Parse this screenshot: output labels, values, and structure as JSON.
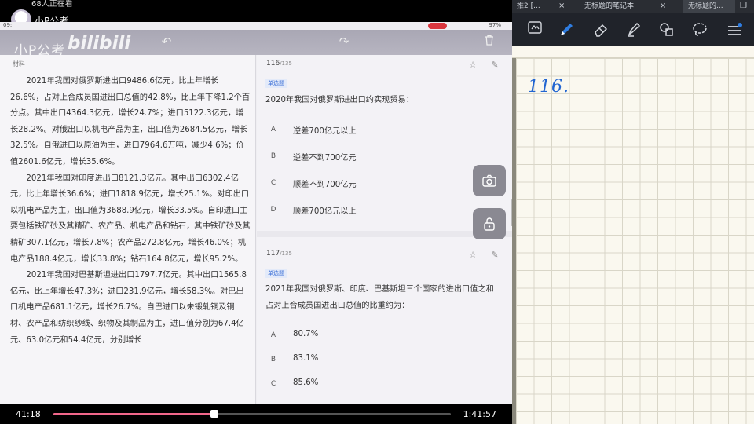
{
  "stream": {
    "viewer_count": "68人正在看",
    "streamer_name": "小P公考"
  },
  "tablet": {
    "status_time": "09:",
    "battery": "97%",
    "watermark_text": "小P公考",
    "watermark_logo": "bilibili",
    "toolbar_icons": [
      "undo-icon",
      "redo-icon",
      "trash-icon"
    ]
  },
  "material": {
    "label": "材料",
    "paragraphs": [
      "2021年我国对俄罗斯进出口9486.6亿元，比上年增长26.6%，占对上合成员国进出口总值的42.8%，比上年下降1.2个百分点。其中出口4364.3亿元，增长24.7%；进口5122.3亿元，增长28.2%。对俄出口以机电产品为主，出口值为2684.5亿元，增长32.5%。自俄进口以原油为主，进口7964.6万吨，减少4.6%；价值2601.6亿元，增长35.6%。",
      "2021年我国对印度进出口8121.3亿元。其中出口6302.4亿元，比上年增长36.6%；进口1818.9亿元，增长25.1%。对印出口以机电产品为主，出口值为3688.9亿元，增长33.5%。自印进口主要包括铁矿砂及其精矿、农产品、机电产品和钻石，其中铁矿砂及其精矿307.1亿元，增长7.8%；农产品272.8亿元，增长46.0%；机电产品188.4亿元，增长33.8%；钻石164.8亿元，增长95.2%。",
      "2021年我国对巴基斯坦进出口1797.7亿元。其中出口1565.8亿元，比上年增长47.3%；进口231.9亿元，增长58.3%。对巴出口机电产品681.1亿元，增长26.7%。自巴进口以未锻轧铜及铜材、农产品和纺织纱线、织物及其制品为主，进口值分别为67.4亿元、63.0亿元和54.4亿元，分别增长"
    ]
  },
  "questions": [
    {
      "number": "116",
      "total": "/135",
      "type": "单选题",
      "stem": "2020年我国对俄罗斯进出口约实现贸易：",
      "options": [
        {
          "letter": "A",
          "text": "逆差700亿元以上"
        },
        {
          "letter": "B",
          "text": "逆差不到700亿元"
        },
        {
          "letter": "C",
          "text": "顺差不到700亿元"
        },
        {
          "letter": "D",
          "text": "顺差700亿元以上"
        }
      ]
    },
    {
      "number": "117",
      "total": "/135",
      "type": "单选题",
      "stem": "2021年我国对俄罗斯、印度、巴基斯坦三个国家的进出口值之和占对上合成员国进出口总值的比重约为：",
      "options": [
        {
          "letter": "A",
          "text": "80.7%"
        },
        {
          "letter": "B",
          "text": "83.1%"
        },
        {
          "letter": "C",
          "text": "85.6%"
        }
      ]
    }
  ],
  "playback": {
    "current_time": "41:18",
    "total_time": "1:41:57",
    "progress": 0.406
  },
  "notes": {
    "tabs": [
      "推2 [...",
      "无标题的笔记本",
      "无标题的..."
    ],
    "tools": [
      "scan-icon",
      "pen-icon",
      "eraser-icon",
      "highlighter-icon",
      "shapes-icon",
      "lasso-icon",
      "menu-icon"
    ],
    "handwriting": "116."
  }
}
